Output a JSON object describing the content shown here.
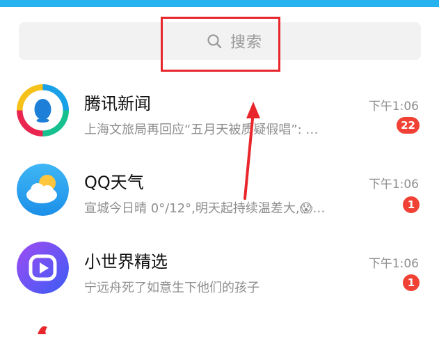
{
  "search": {
    "placeholder": "搜索"
  },
  "chats": [
    {
      "title": "腾讯新闻",
      "preview": "上海文旅局再回应“五月天被质疑假唱”: …",
      "time": "下午1:06",
      "badge": "22",
      "icon": "tencent-news-logo"
    },
    {
      "title": "QQ天气",
      "preview": "宣城今日晴 0°/12°,明天起持续温差大,😱…",
      "time": "下午1:06",
      "badge": "1",
      "icon": "qq-weather-logo"
    },
    {
      "title": "小世界精选",
      "preview": "宁远舟死了如意生下他们的孩子",
      "time": "下午1:06",
      "badge": "1",
      "icon": "small-world-logo"
    }
  ],
  "colors": {
    "accent": "#26b2ee",
    "badge": "#f04134",
    "annotation": "#e8262b"
  }
}
